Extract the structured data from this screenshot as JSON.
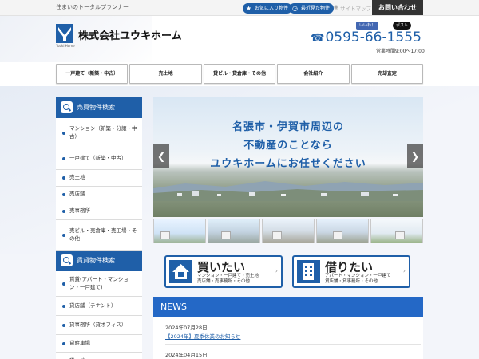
{
  "topbar": {
    "tagline": "住まいのトータルプランナー",
    "favorites_label": "お気に入り物件",
    "recent_label": "最近見た物件",
    "sitemap_label": "サイトマップ",
    "contact_label": "お問い合わせ"
  },
  "header": {
    "logo_sub": "Yuuki Home",
    "company_name": "株式会社ユウキホーム",
    "like_label": "いいね！",
    "post_label": "ポスト",
    "phone": "0595-66-1555",
    "hours": "営業時間9:00～17:00"
  },
  "nav": {
    "items": [
      {
        "label": "一戸建て（新築・中古）"
      },
      {
        "label": "売土地"
      },
      {
        "label": "貸ビル・貸倉庫・その他"
      },
      {
        "label": "会社紹介"
      },
      {
        "label": "売却査定"
      }
    ]
  },
  "sidebar": {
    "buy": {
      "title": "売買物件検索",
      "items": [
        {
          "label": "マンション（新築・分譲・中古）"
        },
        {
          "label": "一戸建て（新築・中古）"
        },
        {
          "label": "売土地"
        },
        {
          "label": "売店舗"
        },
        {
          "label": "売事務所"
        },
        {
          "label": "売ビル・売倉庫・売工場・その他"
        }
      ]
    },
    "rent": {
      "title": "賃貸物件検索",
      "items": [
        {
          "label": "賃貸(アパート・マンション・一戸建て)"
        },
        {
          "label": "貸店舗（テナント）"
        },
        {
          "label": "貸事務所（貸オフィス）"
        },
        {
          "label": "貸駐車場"
        },
        {
          "label": "貸土地"
        }
      ]
    }
  },
  "slider": {
    "line1": "名張市・伊賀市周辺の",
    "line2": "不動産のことなら",
    "line3": "ユウキホームにお任せください",
    "prev_label": "❮",
    "next_label": "❯"
  },
  "categories": {
    "buy": {
      "title": "買いたい",
      "sub1": "マンション・一戸建て・売土地",
      "sub2": "売店舗・売事務所・その他"
    },
    "rent": {
      "title": "借りたい",
      "sub1": "アパート・マンション・一戸建て",
      "sub2": "貸店舗・貸事務所・その他"
    }
  },
  "news": {
    "heading": "NEWS",
    "items": [
      {
        "date": "2024年07月28日",
        "title": "【2024年】夏季休業のお知らせ"
      },
      {
        "date": "2024年04月15日",
        "title": ""
      }
    ]
  },
  "colors": {
    "primary": "#1f5fa8",
    "news_header": "#2468c6",
    "contact_button": "#333333"
  }
}
